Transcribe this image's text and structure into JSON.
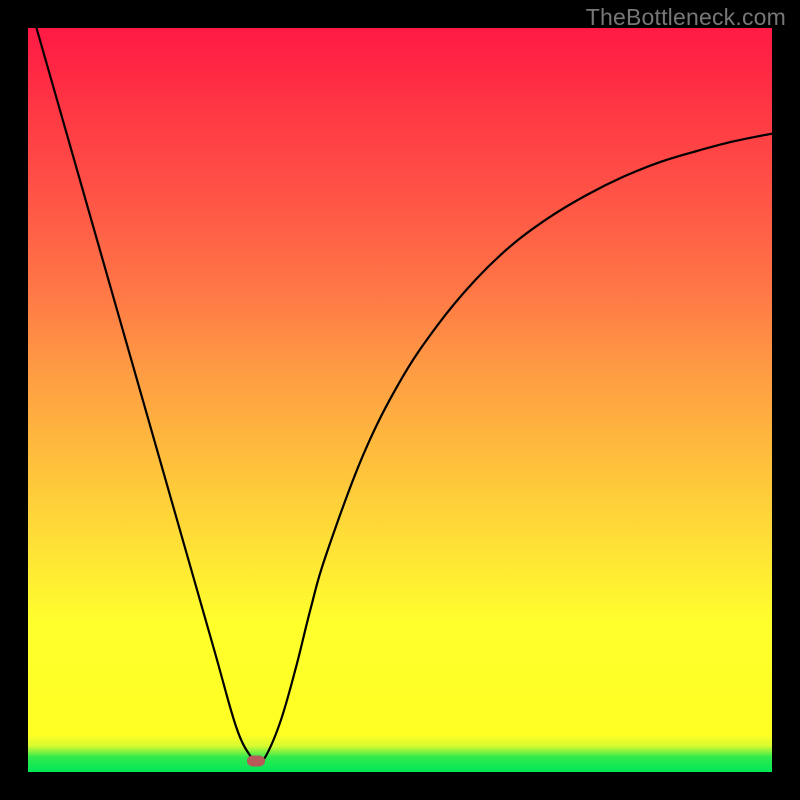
{
  "watermark": "TheBottleneck.com",
  "chart_data": {
    "type": "line",
    "title": "",
    "xlabel": "",
    "ylabel": "",
    "xlim": [
      0,
      100
    ],
    "ylim": [
      0,
      100
    ],
    "series": [
      {
        "name": "curve",
        "x": [
          0,
          5,
          10,
          15,
          20,
          25,
          28,
          30,
          31,
          32,
          34,
          36,
          38,
          40,
          45,
          50,
          55,
          60,
          65,
          70,
          75,
          80,
          85,
          90,
          95,
          100
        ],
        "values": [
          104,
          86.5,
          69,
          51.5,
          34.0,
          16.5,
          6.0,
          2.0,
          1.5,
          2.2,
          7.0,
          14.0,
          22.0,
          29.0,
          42.5,
          52.5,
          60.0,
          66.0,
          70.8,
          74.5,
          77.5,
          80.0,
          82.0,
          83.5,
          84.8,
          85.8
        ]
      }
    ],
    "annotations": [
      {
        "name": "minimum_marker",
        "x": 30.6,
        "y": 1.5,
        "color": "#b85a5a"
      }
    ],
    "background_gradient": {
      "direction": "vertical",
      "stops": [
        {
          "pos": 0,
          "color": "#00e756"
        },
        {
          "pos": 5,
          "color": "#ffff24"
        },
        {
          "pos": 45,
          "color": "#ffb63e"
        },
        {
          "pos": 78,
          "color": "#ff5246"
        },
        {
          "pos": 100,
          "color": "#ff1a45"
        }
      ]
    }
  },
  "plot_geometry": {
    "inner_width": 744,
    "inner_height": 744
  }
}
